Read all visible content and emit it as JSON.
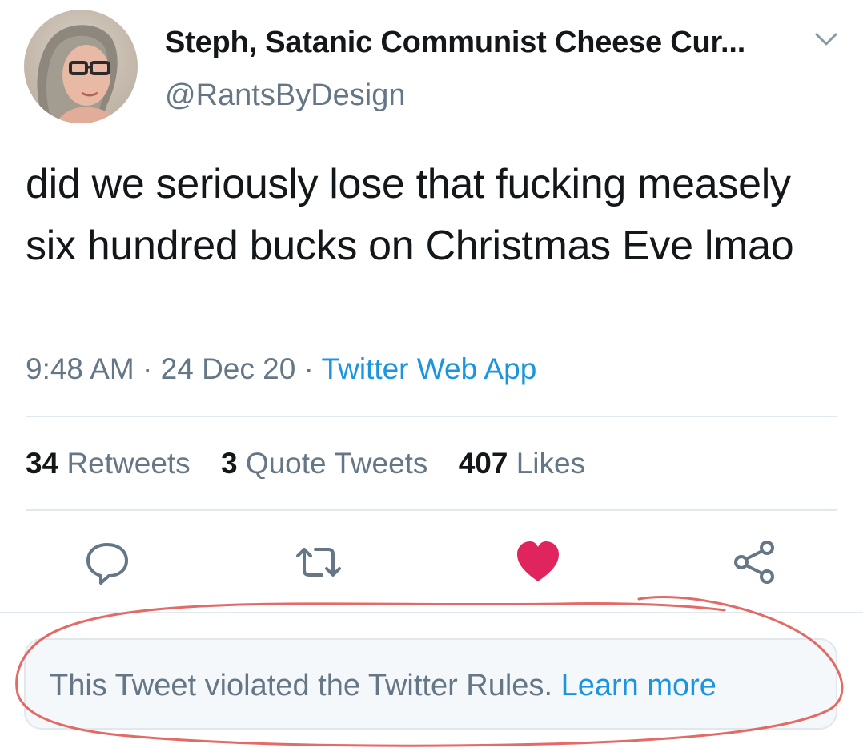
{
  "author": {
    "display_name": "Steph, Satanic Communist Cheese Cur...",
    "handle": "@RantsByDesign"
  },
  "tweet": {
    "text": "did we seriously lose that fucking measely six hundred bucks on Christmas Eve lmao",
    "time": "9:48 AM",
    "date": "24 Dec 20",
    "separator": " · ",
    "source": "Twitter Web App"
  },
  "stats": {
    "retweets_count": "34",
    "retweets_label": "Retweets",
    "quotes_count": "3",
    "quotes_label": "Quote Tweets",
    "likes_count": "407",
    "likes_label": "Likes"
  },
  "actions": {
    "reply_icon": "reply-icon",
    "retweet_icon": "retweet-icon",
    "like_icon": "heart-icon",
    "share_icon": "share-icon",
    "liked": true
  },
  "notice": {
    "text": "This Tweet violated the Twitter Rules.",
    "link": "Learn more"
  },
  "colors": {
    "primary_text": "#14171a",
    "secondary_text": "#657786",
    "link": "#1b95e0",
    "like": "#e0245e",
    "annotation": "#e05a55"
  }
}
